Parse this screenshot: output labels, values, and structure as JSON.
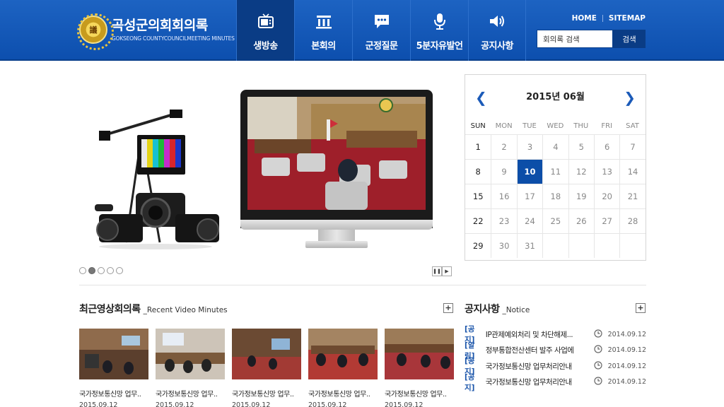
{
  "header": {
    "logo_title": "곡성군의회회의록",
    "logo_subtitle": "GOKSEONG COUNTYCOUNCILMEETING MINUTES",
    "seal_text": "議",
    "nav": [
      {
        "label": "생방송",
        "icon": "tv-icon"
      },
      {
        "label": "본회의",
        "icon": "building-icon"
      },
      {
        "label": "군정질문",
        "icon": "speech-bubble-icon"
      },
      {
        "label": "5분자유발언",
        "icon": "microphone-icon"
      },
      {
        "label": "공지사항",
        "icon": "speaker-icon"
      }
    ],
    "active_nav": "생방송",
    "home_label": "HOME",
    "sitemap_label": "SITEMAP",
    "search_value": "회의록 검색",
    "search_button": "검색"
  },
  "slider": {
    "dot_count": 5,
    "active_dot": 2
  },
  "calendar": {
    "month_label": "2015년 06월",
    "weekdays": [
      "SUN",
      "MON",
      "TUE",
      "WED",
      "THU",
      "FRI",
      "SAT"
    ],
    "days": [
      "1",
      "2",
      "3",
      "4",
      "5",
      "6",
      "7",
      "8",
      "9",
      "10",
      "11",
      "12",
      "13",
      "14",
      "15",
      "16",
      "17",
      "18",
      "19",
      "20",
      "21",
      "22",
      "23",
      "24",
      "25",
      "26",
      "27",
      "28",
      "29",
      "30",
      "31"
    ],
    "today": "10",
    "highlight_color": "#0c4ea8"
  },
  "recent_videos": {
    "title": "최근영상회의록",
    "subtitle": "_Recent Video Minutes",
    "items": [
      {
        "title": "국가정보통신망 업무..",
        "date": "2015.09.12"
      },
      {
        "title": "국가정보통신망 업무..",
        "date": "2015.09.12"
      },
      {
        "title": "국가정보통신망 업무..",
        "date": "2015.09.12"
      },
      {
        "title": "국가정보통신망 업무..",
        "date": "2015.09.12"
      },
      {
        "title": "국가정보통신망 업무..",
        "date": "2015.09.12"
      }
    ]
  },
  "notices": {
    "title": "공지사항",
    "subtitle": "_Notice",
    "items": [
      {
        "tag": "[공지]",
        "title": "IP관제예외처리 및 차단해제...",
        "date": "2014.09.12"
      },
      {
        "tag": "[알림]",
        "title": "정부통합전산센터 발주 사업에...",
        "date": "2014.09.12"
      },
      {
        "tag": "[공지]",
        "title": "국가정보통신망 업무처리안내",
        "date": "2014.09.12"
      },
      {
        "tag": "[공지]",
        "title": "국가정보통신망 업무처리안내",
        "date": "2014.09.12"
      }
    ]
  },
  "colors": {
    "header_blue": "#1d63c2",
    "active_nav": "#0a3c85",
    "accent": "#1b55aa"
  }
}
